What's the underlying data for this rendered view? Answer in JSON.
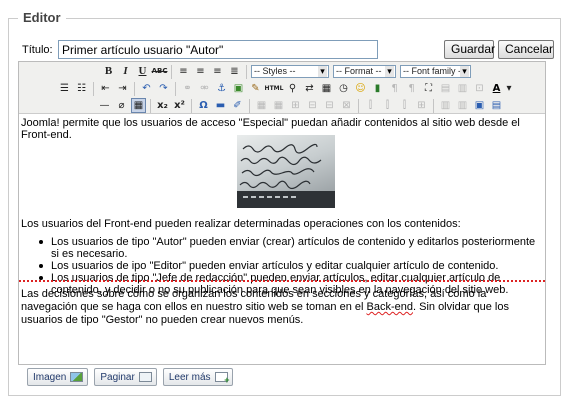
{
  "legend": "Editor",
  "title_field": {
    "label": "Título:",
    "value": "Primer artículo usuario \"Autor\""
  },
  "buttons": {
    "save": "Guardar",
    "cancel": "Cancelar"
  },
  "toolbar": {
    "row1": {
      "bold": "B",
      "italic": "I",
      "underline": "U",
      "strike": "ABC",
      "styles": "-- Styles --",
      "format": "-- Format --",
      "font_family": "-- Font family --"
    },
    "row2": {
      "html_label": "HTML"
    },
    "row3": {
      "subscript": "x₂",
      "superscript": "x²",
      "omega": "Ω"
    }
  },
  "content": {
    "p1": "Joomla! permite que los usuarios de acceso \"Especial\" puedan añadir contenidos al sitio web desde el Front-end.",
    "p2": "Los usuarios del Front-end pueden realizar determinadas operaciones con los contenidos:",
    "list": [
      "Los usuarios de tipo \"Autor\" pueden enviar (crear) artículos de contenido y editarlos posteriormente si es necesario.",
      "Los usuarios de ipo \"Editor\" pueden enviar artículos y editar cualquier artículo de contenido.",
      "Los usuarios de tipo \"Jefe de redacción\" pueden enviar artículos, editar cualquier artículo de contenido, y decidir o no su publicación para que sean visibles en la navegación del sitio web."
    ],
    "p3_before": "Las decisiones sobre cómo se organizan los contenidos en secciones y categorías, así como la navegación que se haga con ellos en nuestro sitio web se toman en el ",
    "p3_spell": "Back-end",
    "p3_after": ". Sin olvidar que los usuarios de tipo \"Gestor\" no pueden crear nuevos menús."
  },
  "bottom_buttons": {
    "image": "Imagen",
    "pagebreak": "Paginar",
    "readmore": "Leer más"
  },
  "colors": {
    "pagebreak_line": "#dd2222",
    "border": "#cccccc"
  }
}
